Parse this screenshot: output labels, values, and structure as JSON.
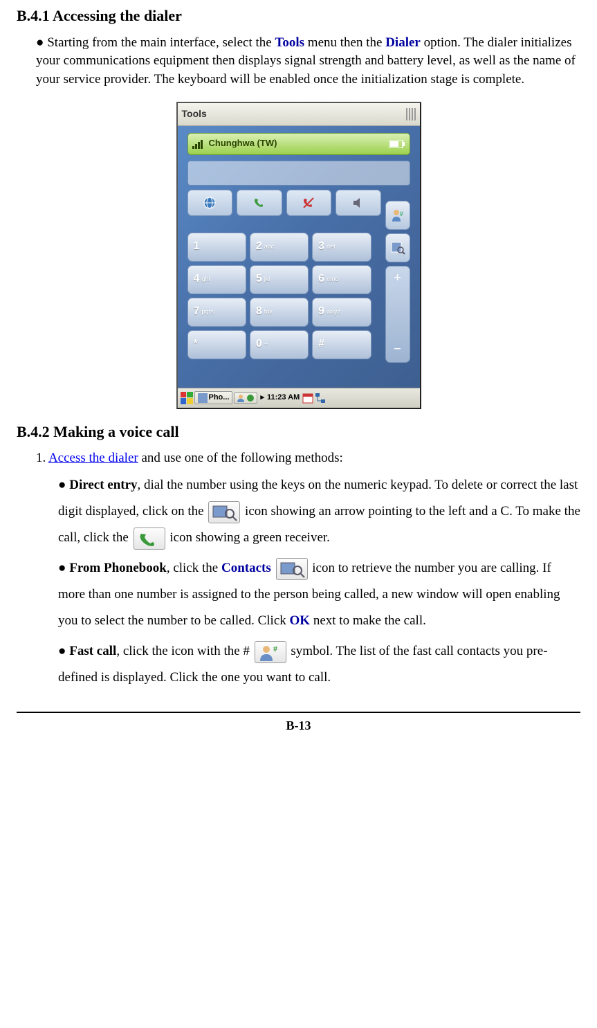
{
  "section1": {
    "heading": "B.4.1 Accessing the dialer",
    "bullet1": {
      "pre": "● Starting from the main interface, select the ",
      "tools": "Tools",
      "mid1": " menu then the ",
      "dialer": "Dialer",
      "post": " option. The dialer initializes your communications equipment then displays signal strength and battery level, as well as the name of your service provider. The keyboard will be enabled once the initialization stage is complete."
    }
  },
  "pda": {
    "title": "Tools",
    "carrier": "Chunghwa (TW)",
    "keys": [
      {
        "n": "1",
        "l": ""
      },
      {
        "n": "2",
        "l": "abc"
      },
      {
        "n": "3",
        "l": "def"
      },
      {
        "n": "4",
        "l": "ghi"
      },
      {
        "n": "5",
        "l": "jkl"
      },
      {
        "n": "6",
        "l": "mno"
      },
      {
        "n": "7",
        "l": "pqrs"
      },
      {
        "n": "8",
        "l": "tuv"
      },
      {
        "n": "9",
        "l": "wxyz"
      },
      {
        "n": "*",
        "l": ""
      },
      {
        "n": "0",
        "l": "+"
      },
      {
        "n": "#",
        "l": ""
      }
    ],
    "task_app": "Pho...",
    "time": "11:23 AM"
  },
  "section2": {
    "heading": "B.4.2 Making a voice call",
    "intro": {
      "pre": "1. ",
      "link": "Access the dialer",
      "post": " and use one of the following methods:"
    },
    "direct": {
      "lead": "● ",
      "bold": "Direct entry",
      "t1": ", dial the number using the keys on the numeric keypad. To delete or correct the last digit displayed, click on the ",
      "t2": " icon showing an arrow pointing to the left and a C. To make the call, click the ",
      "t3": " icon showing a green receiver."
    },
    "phonebook": {
      "lead": "● ",
      "bold": "From Phonebook",
      "t1": ", click the ",
      "contacts": "Contacts",
      "t2": " ",
      "t3": " icon to retrieve the number you are calling. If more than one number is assigned to the person being called, a new window will open enabling you to select the number to be called. Click ",
      "ok": "OK",
      "t4": " next to make the call."
    },
    "fast": {
      "lead": "● ",
      "bold": "Fast call",
      "t1": ", click the icon with the # ",
      "t2": " symbol. The list of the fast call contacts you pre-defined is displayed. Click the one you want to call."
    }
  },
  "footer": {
    "page": "B-13"
  }
}
